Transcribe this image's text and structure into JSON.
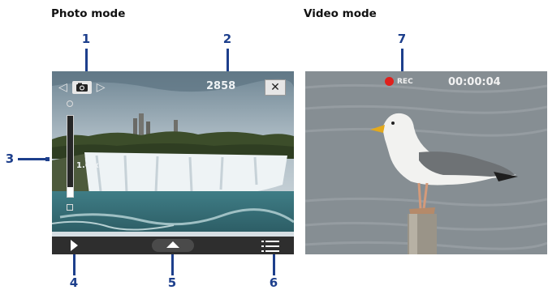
{
  "headings": {
    "photo": "Photo mode",
    "video": "Video mode"
  },
  "photo": {
    "shot_count": "2858",
    "zoom": "1.0 x",
    "zoom_level_fraction": 0.12
  },
  "video": {
    "rec_label": "REC",
    "timer": "00:00:04"
  },
  "callouts": [
    "1",
    "2",
    "3",
    "4",
    "5",
    "6",
    "7"
  ],
  "colors": {
    "callout": "#1d3f8c",
    "rec_dot": "#e0201c",
    "toolbar": "#2e2e2e"
  },
  "icons": {
    "camera_mode": "camera-icon",
    "close": "close-icon",
    "play": "play-icon",
    "eject": "eject-icon",
    "menu": "menu-icon"
  }
}
